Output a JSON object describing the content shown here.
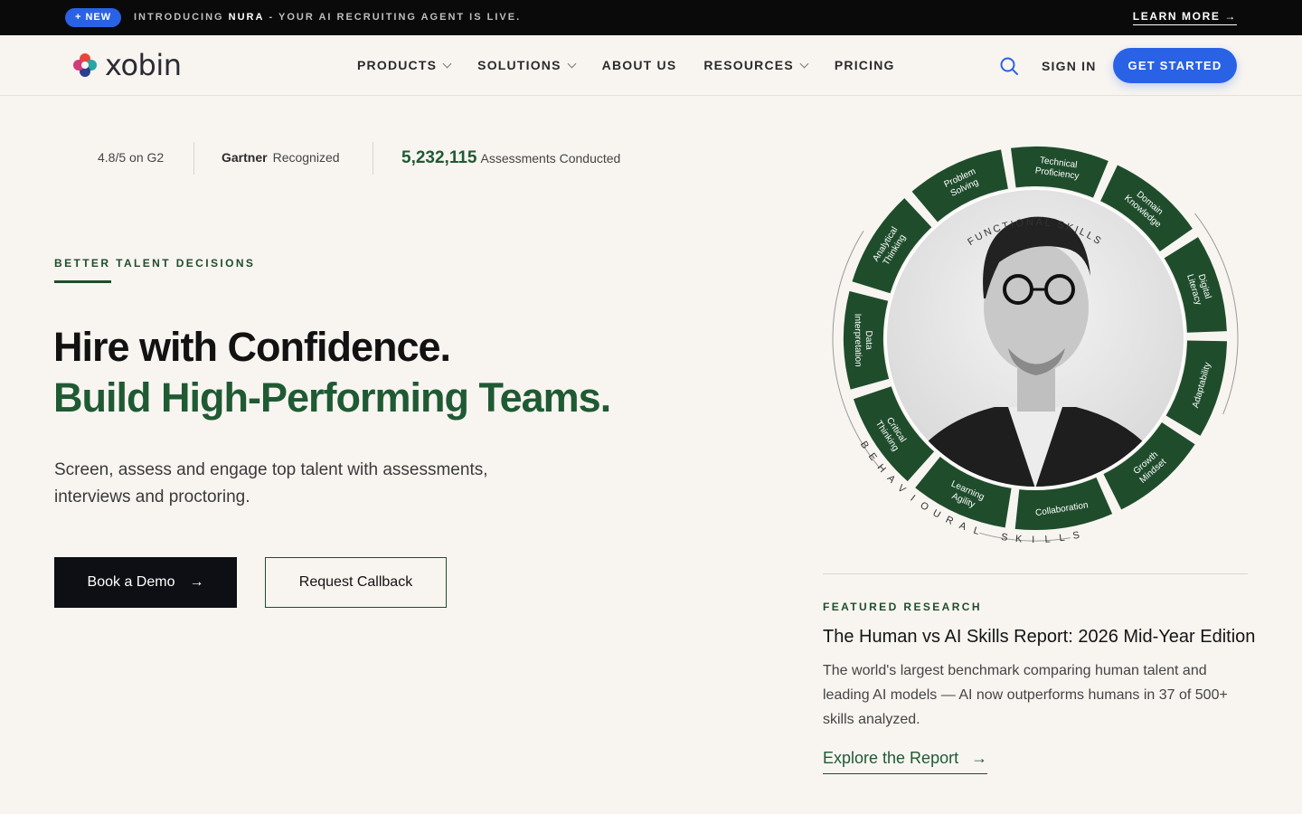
{
  "announcement": {
    "badge": "+ NEW",
    "text_prefix": "INTRODUCING",
    "text_brand": "NURA",
    "text_suffix": "- YOUR AI RECRUITING AGENT IS LIVE.",
    "link": "LEARN MORE"
  },
  "nav": {
    "logo": "xobin",
    "items": [
      {
        "label": "PRODUCTS",
        "has_dropdown": true
      },
      {
        "label": "SOLUTIONS",
        "has_dropdown": true
      },
      {
        "label": "ABOUT US",
        "has_dropdown": false
      },
      {
        "label": "RESOURCES",
        "has_dropdown": true
      },
      {
        "label": "PRICING",
        "has_dropdown": false
      }
    ],
    "sign_in": "SIGN IN",
    "cta": "GET STARTED"
  },
  "stats": {
    "g2": "4.8/5 on G2",
    "gartner_bold": "Gartner",
    "gartner_rest": "Recognized",
    "assessments_number": "5,232,115",
    "assessments_label": "Assessments Conducted"
  },
  "hero": {
    "eyebrow": "BETTER TALENT DECISIONS",
    "headline_1": "Hire with Confidence.",
    "headline_2": "Build High-Performing Teams.",
    "subtext": "Screen, assess and engage top talent with assessments, interviews and proctoring.",
    "primary_cta": "Book a Demo",
    "secondary_cta": "Request Callback"
  },
  "skills_wheel": {
    "top_label": "FUNCTIONAL SKILLS",
    "bottom_label": "BEHAVIOURAL SKILLS",
    "segments": [
      "Data Interpretation",
      "Analytical Thinking",
      "Problem Solving",
      "Technical Proficiency",
      "Domain Knowledge",
      "Digital Literacy",
      "Adaptability",
      "Growth Mindset",
      "Collaboration",
      "Learning Agility",
      "Critical Thinking"
    ]
  },
  "featured": {
    "eyebrow": "FEATURED RESEARCH",
    "title": "The Human vs AI Skills Report: 2026 Mid-Year Edition",
    "description": "The world's largest benchmark comparing human talent and leading AI models — AI now outperforms humans in 37 of 500+ skills analyzed.",
    "link": "Explore the Report"
  },
  "colors": {
    "accent_blue": "#2a62e6",
    "brand_green": "#1f5a33",
    "wheel_green": "#1f4d2c",
    "background": "#f8f5f1"
  },
  "icons": {
    "search": "search-icon",
    "arrow": "arrow-right-icon",
    "chevron": "chevron-down-icon"
  }
}
